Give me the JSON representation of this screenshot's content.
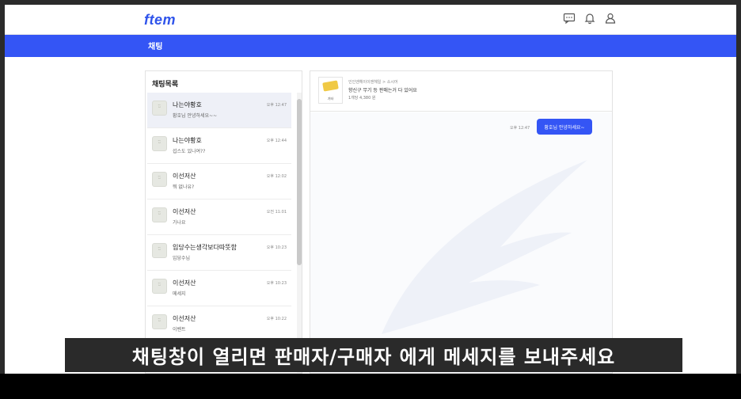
{
  "header": {
    "logo": "ftem",
    "icons": [
      "chat-icon",
      "bell-icon",
      "user-icon"
    ]
  },
  "nav": {
    "title": "채팅"
  },
  "chat_list": {
    "title": "채팅목록",
    "items": [
      {
        "name": "나는야황호",
        "message": "황호님 안녕하세요~~",
        "time": "오후 12:47"
      },
      {
        "name": "나는야황호",
        "message": "섭스도 있나여??",
        "time": "오후 12:44"
      },
      {
        "name": "이선저산",
        "message": "뭐 없나유?",
        "time": "오후 12:02"
      },
      {
        "name": "이선저산",
        "message": "가나요",
        "time": "오전 11:01"
      },
      {
        "name": "입당수는생각보다따뜻함",
        "message": "입당수님",
        "time": "오후 10:23"
      },
      {
        "name": "이선저산",
        "message": "메세지",
        "time": "오후 10:23"
      },
      {
        "name": "이선저산",
        "message": "이벤트",
        "time": "오후 10:22"
      }
    ]
  },
  "product": {
    "thumb_label": "기타",
    "category": "인인엔헤이이엔헤일 > 소시어",
    "title": "향신구 무기 등 판매는거 다 있어요",
    "price": "1개당 4,380 원"
  },
  "messages": [
    {
      "time": "오후 12:47",
      "text": "황호님 안녕하세요~"
    }
  ],
  "subtitle": "채팅창이 열리면 판매자/구매자 에게 메세지를 보내주세요",
  "colors": {
    "brand_blue": "#3455f5",
    "subtitle_bg": "#2a2a2a"
  }
}
